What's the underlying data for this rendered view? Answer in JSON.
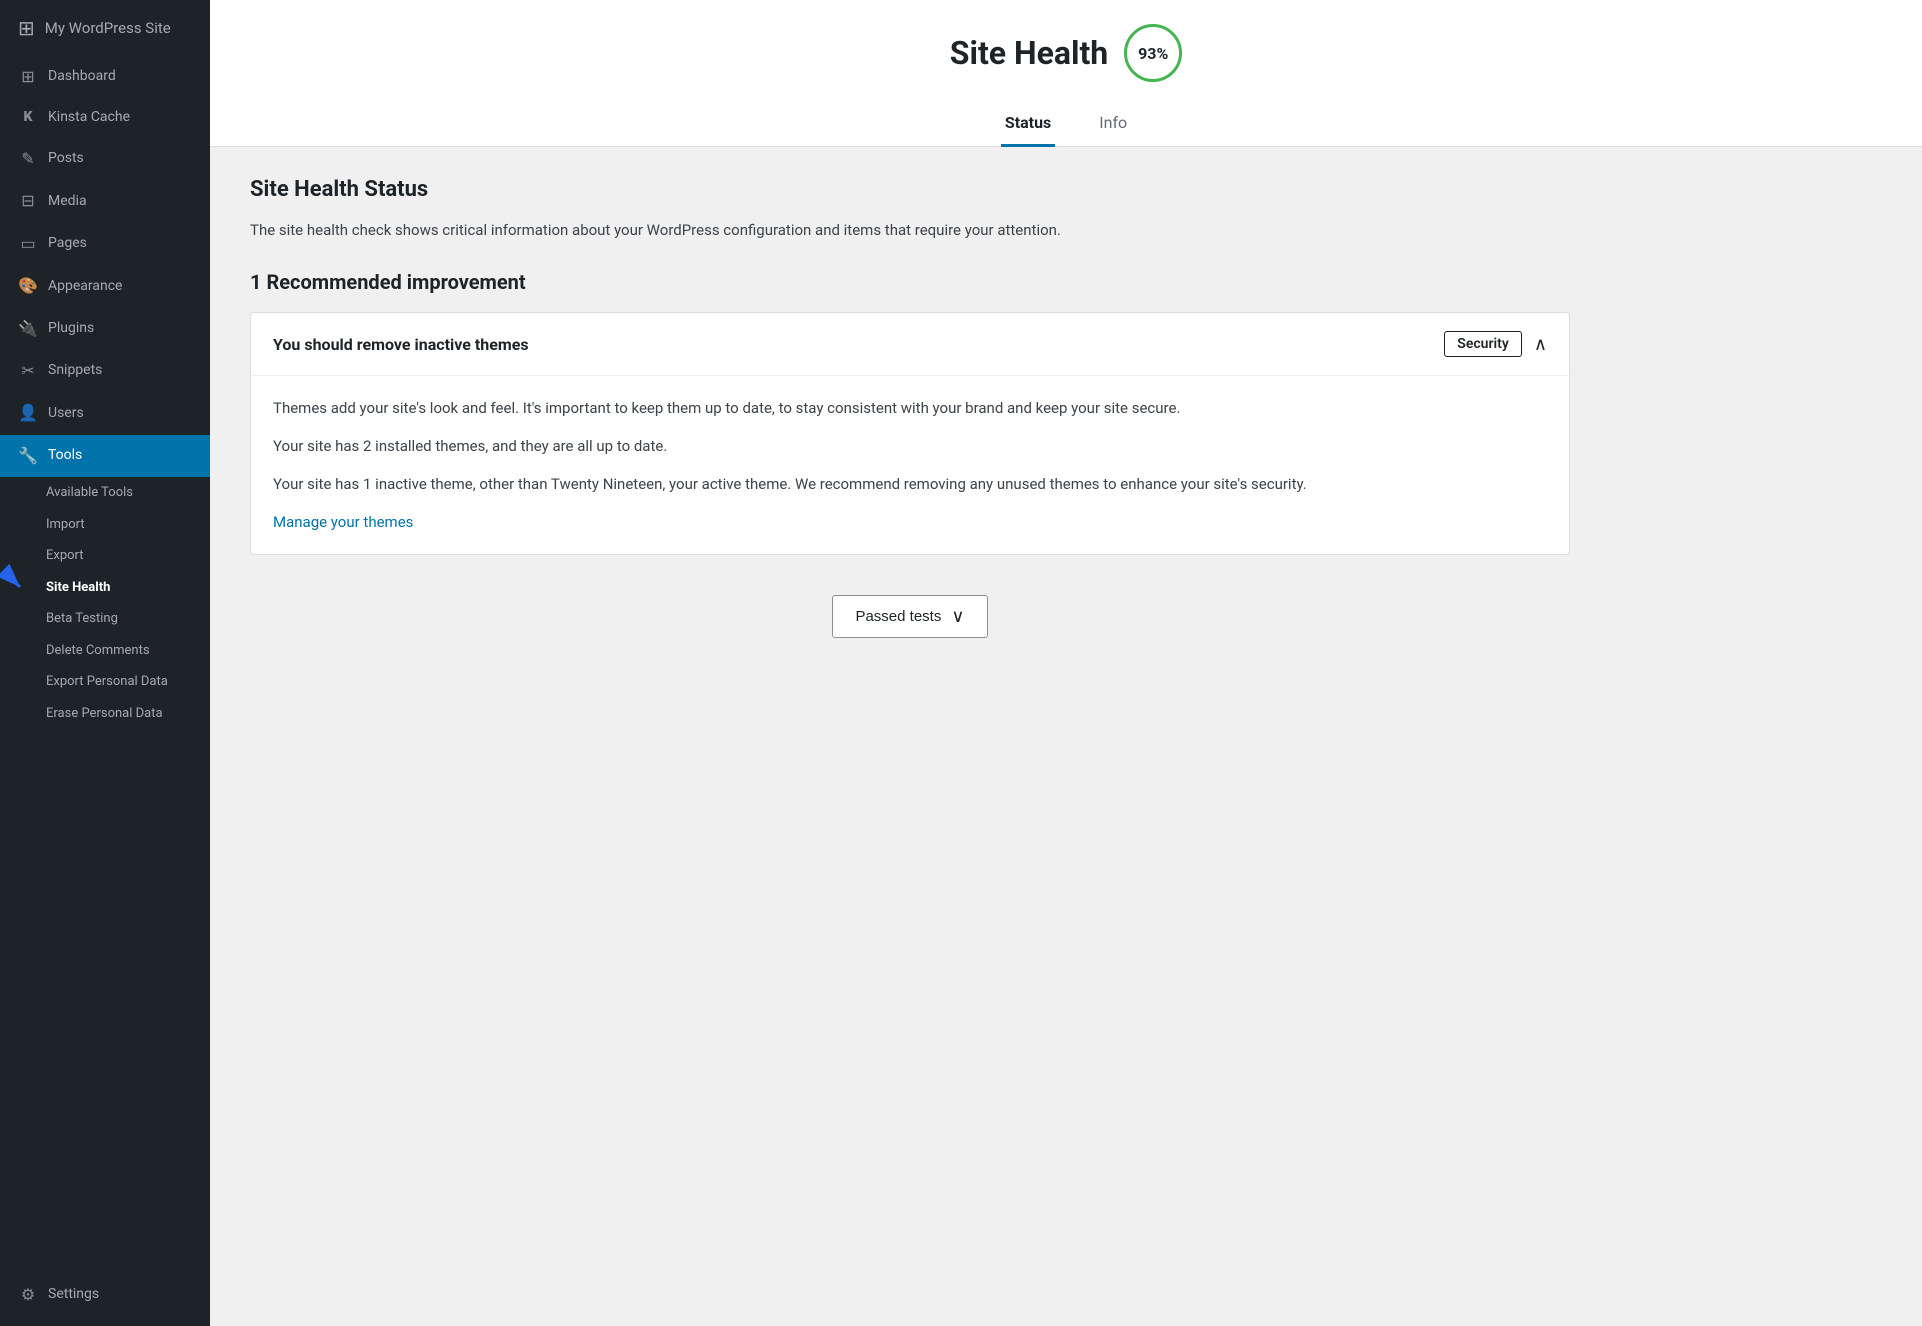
{
  "sidebar": {
    "items": [
      {
        "id": "dashboard",
        "label": "Dashboard",
        "icon": "⊞"
      },
      {
        "id": "kinsta-cache",
        "label": "Kinsta Cache",
        "icon": "K"
      },
      {
        "id": "posts",
        "label": "Posts",
        "icon": "✎"
      },
      {
        "id": "media",
        "label": "Media",
        "icon": "⊟"
      },
      {
        "id": "pages",
        "label": "Pages",
        "icon": "▭"
      },
      {
        "id": "appearance",
        "label": "Appearance",
        "icon": "🎨"
      },
      {
        "id": "plugins",
        "label": "Plugins",
        "icon": "🔌"
      },
      {
        "id": "snippets",
        "label": "Snippets",
        "icon": "✂"
      },
      {
        "id": "users",
        "label": "Users",
        "icon": "👤"
      },
      {
        "id": "tools",
        "label": "Tools",
        "icon": "🔧",
        "active": true
      }
    ],
    "subitems": [
      {
        "id": "available-tools",
        "label": "Available Tools"
      },
      {
        "id": "import",
        "label": "Import"
      },
      {
        "id": "export",
        "label": "Export"
      },
      {
        "id": "site-health",
        "label": "Site Health",
        "active": true
      },
      {
        "id": "beta-testing",
        "label": "Beta Testing"
      },
      {
        "id": "delete-comments",
        "label": "Delete Comments"
      },
      {
        "id": "export-personal-data",
        "label": "Export Personal Data"
      },
      {
        "id": "erase-personal-data",
        "label": "Erase Personal Data"
      }
    ],
    "settings": {
      "id": "settings",
      "label": "Settings",
      "icon": "⚙"
    }
  },
  "header": {
    "title": "Site Health",
    "score": "93%",
    "tabs": [
      {
        "id": "status",
        "label": "Status",
        "active": true
      },
      {
        "id": "info",
        "label": "Info",
        "active": false
      }
    ]
  },
  "content": {
    "section_title": "Site Health Status",
    "section_description": "The site health check shows critical information about your WordPress configuration and items that require your attention.",
    "improvement_title": "1 Recommended improvement",
    "card": {
      "title": "You should remove inactive themes",
      "badge": "Security",
      "paragraphs": [
        "Themes add your site's look and feel. It's important to keep them up to date, to stay consistent with your brand and keep your site secure.",
        "Your site has 2 installed themes, and they are all up to date.",
        "Your site has 1 inactive theme, other than Twenty Nineteen, your active theme. We recommend removing any unused themes to enhance your site's security."
      ],
      "link_text": "Manage your themes",
      "link_href": "#"
    },
    "passed_tests_button": "Passed tests",
    "passed_tests_icon": "∨"
  }
}
